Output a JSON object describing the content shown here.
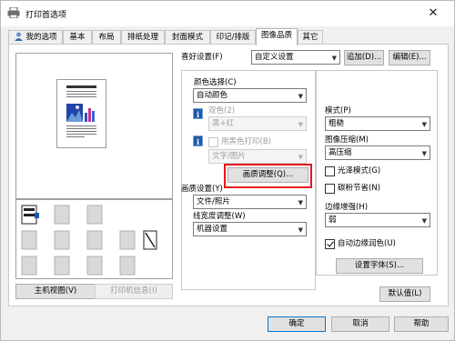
{
  "window": {
    "title": "打印首选项",
    "close_glyph": "✕"
  },
  "tabs": [
    {
      "label": "我的选项"
    },
    {
      "label": "基本"
    },
    {
      "label": "布局"
    },
    {
      "label": "排纸处理"
    },
    {
      "label": "封面模式"
    },
    {
      "label": "印记/排版"
    },
    {
      "label": "图像品质",
      "active": true
    },
    {
      "label": "其它"
    }
  ],
  "left": {
    "main_view_button": "主机视图(V)",
    "printer_info_button": "打印机信息(I)"
  },
  "favorites": {
    "label": "喜好设置(F)",
    "value": "自定义设置",
    "add_button": "追加(D)...",
    "edit_button": "编辑(E)..."
  },
  "color": {
    "label": "颜色选择(C)",
    "value": "自动颜色",
    "two_color_label": "双色(2)",
    "two_color_value": "黑+红",
    "black_print_label": "用黑色打印(B)",
    "black_print_value": "文字/图片",
    "quality_adjust_button": "画质调整(Q)..."
  },
  "quality": {
    "label": "画质设置(Y)",
    "value": "文件/照片"
  },
  "line_width": {
    "label": "线宽度调整(W)",
    "value": "机器设置"
  },
  "right": {
    "mode_label": "模式(P)",
    "mode_value": "粗糙",
    "compression_label": "图像压缩(M)",
    "compression_value": "高压缩",
    "glossy_label": "光泽模式(G)",
    "toner_save_label": "碳粉节省(N)",
    "edge_label": "边缘增强(H)",
    "edge_value": "弱",
    "auto_trapping_label": "自动边缘润色(U)",
    "auto_trapping_checked": true,
    "font_settings_button": "设置字体(S)..."
  },
  "default_button": "默认值(L)",
  "footer": {
    "ok": "确定",
    "cancel": "取消",
    "help": "帮助"
  },
  "colors": {
    "highlight": "#e8151b",
    "info_icon": "#1e5ca8"
  },
  "icons": [
    "printer-icon",
    "user-icon",
    "info-icon",
    "chevron-down-icon",
    "close-icon"
  ]
}
